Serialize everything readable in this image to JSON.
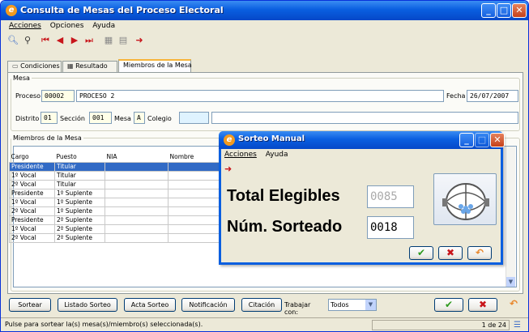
{
  "main_window": {
    "title": "Consulta de Mesas del Proceso Electoral",
    "menu": [
      "Acciones",
      "Opciones",
      "Ayuda"
    ],
    "toolbar_icons": [
      "search-icon",
      "binoculars-icon",
      "first-record-icon",
      "previous-record-icon",
      "next-record-icon",
      "last-record-icon",
      "copy-icon",
      "print-icon",
      "exit-icon"
    ],
    "tabs": [
      "Condiciones",
      "Resultado",
      "Miembros de la Mesa"
    ],
    "active_tab": "Miembros de la Mesa"
  },
  "mesa": {
    "legend": "Mesa",
    "proceso_label": "Proceso",
    "proceso_code": "00002",
    "proceso_name": "PROCESO 2",
    "fecha_label": "Fecha",
    "fecha_value": "26/07/2007",
    "distrito_label": "Distrito",
    "distrito_value": "01",
    "seccion_label": "Sección",
    "seccion_value": "001",
    "mesa_label": "Mesa",
    "mesa_value": "A",
    "colegio_label": "Colegio",
    "colegio_code": "",
    "colegio_name": ""
  },
  "miembros": {
    "legend": "Miembros de la Mesa",
    "columns": [
      "Cargo",
      "Puesto",
      "NIA",
      "Nombre"
    ],
    "rows": [
      {
        "cargo": "Presidente",
        "puesto": "Titular",
        "selected": true
      },
      {
        "cargo": "1º Vocal",
        "puesto": "Titular",
        "selected": false
      },
      {
        "cargo": "2º Vocal",
        "puesto": "Titular",
        "selected": false
      },
      {
        "cargo": "Presidente",
        "puesto": "1º Suplente",
        "selected": false
      },
      {
        "cargo": "1º Vocal",
        "puesto": "1º Suplente",
        "selected": false
      },
      {
        "cargo": "2º Vocal",
        "puesto": "1º Suplente",
        "selected": false
      },
      {
        "cargo": "Presidente",
        "puesto": "2º Suplente",
        "selected": false
      },
      {
        "cargo": "1º Vocal",
        "puesto": "2º Suplente",
        "selected": false
      },
      {
        "cargo": "2º Vocal",
        "puesto": "2º Suplente",
        "selected": false
      }
    ]
  },
  "buttons": {
    "sortear": "Sortear",
    "listado": "Listado Sorteo",
    "acta": "Acta Sorteo",
    "notificacion": "Notificación",
    "citacion": "Citación",
    "trabajar_label": "Trabajar con:",
    "trabajar_value": "Todos"
  },
  "status": {
    "message": "Pulse para sortear la(s) mesa(s)/miembro(s) seleccionada(s).",
    "page": "1 de 24"
  },
  "dialog": {
    "title": "Sorteo Manual",
    "menu": [
      "Acciones",
      "Ayuda"
    ],
    "elegibles_label": "Total Elegibles",
    "elegibles_value": "0085",
    "sorteado_label": "Núm. Sorteado",
    "sorteado_value": "0018"
  },
  "colors": {
    "titlebar": "#0a5fe0",
    "selection": "#316ac5",
    "ok_green": "#2f9a1f",
    "cancel_red": "#c8151b",
    "undo_orange": "#e8862a"
  }
}
